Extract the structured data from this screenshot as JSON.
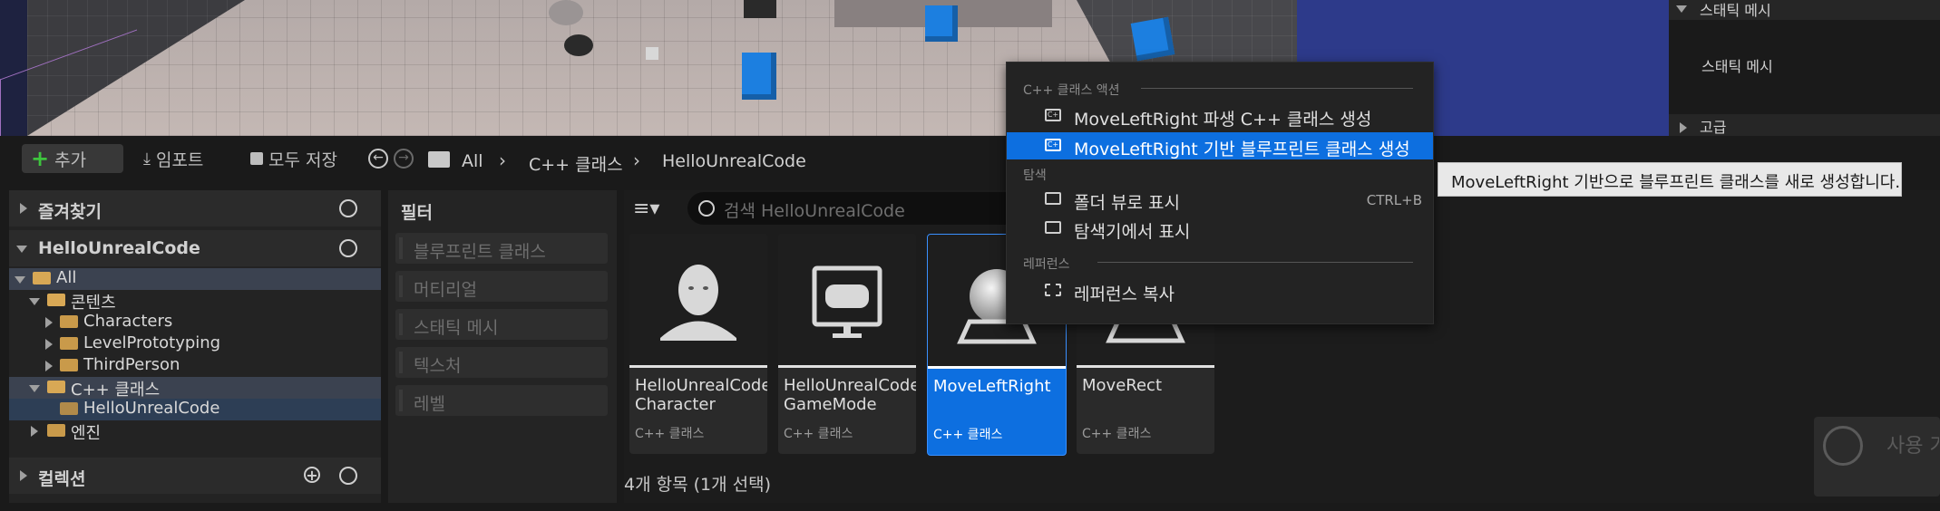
{
  "viewport_details": {
    "static_mesh_section": "스태틱 메시",
    "static_mesh_label": "스태틱 메시",
    "advanced_section": "고급"
  },
  "toolbar": {
    "add_label": "추가",
    "import_label": "임포트",
    "save_all_label": "모두 저장",
    "breadcrumb": [
      "All",
      "C++ 클래스",
      "HelloUnrealCode"
    ]
  },
  "sidebar": {
    "favorites_label": "즐겨찾기",
    "project_label": "HelloUnrealCode",
    "tree": [
      {
        "label": "All"
      },
      {
        "label": "콘텐츠"
      },
      {
        "label": "Characters"
      },
      {
        "label": "LevelPrototyping"
      },
      {
        "label": "ThirdPerson"
      },
      {
        "label": "C++ 클래스"
      },
      {
        "label": "HelloUnrealCode"
      },
      {
        "label": "엔진"
      }
    ],
    "collections_label": "컬렉션"
  },
  "filters": {
    "title": "필터",
    "items": [
      "블루프린트 클래스",
      "머티리얼",
      "스태틱 메시",
      "텍스처",
      "레벨"
    ]
  },
  "search": {
    "placeholder": "검색 HelloUnrealCode"
  },
  "assets": [
    {
      "name": "HelloUnrealCode Character",
      "type": "C++ 클래스",
      "icon": "character-icon",
      "selected": false
    },
    {
      "name": "HelloUnrealCode GameMode",
      "type": "C++ 클래스",
      "icon": "gamemode-icon",
      "selected": false
    },
    {
      "name": "MoveLeftRight",
      "type": "C++ 클래스",
      "icon": "actor-sphere-icon",
      "selected": true
    },
    {
      "name": "MoveRect",
      "type": "C++ 클래스",
      "icon": "actor-icon",
      "selected": false
    }
  ],
  "status": {
    "item_count": "4개 항목 (1개 선택)"
  },
  "context_menu": {
    "section_cpp": "C++ 클래스 액션",
    "create_cpp_derived": "MoveLeftRight 파생 C++ 클래스 생성",
    "create_bp_based": "MoveLeftRight 기반 블루프린트 클래스 생성",
    "section_explore": "탐색",
    "show_in_folder_view": "폴더 뷰로 표시",
    "show_in_folder_view_shortcut": "CTRL+B",
    "show_in_explorer": "탐색기에서 표시",
    "section_references": "레퍼런스",
    "copy_reference": "레퍼런스 복사"
  },
  "tooltip": {
    "text": "MoveLeftRight 기반으로 블루프린트 클래스를 새로 생성합니다."
  },
  "watermark": {
    "text": "사용 가"
  }
}
